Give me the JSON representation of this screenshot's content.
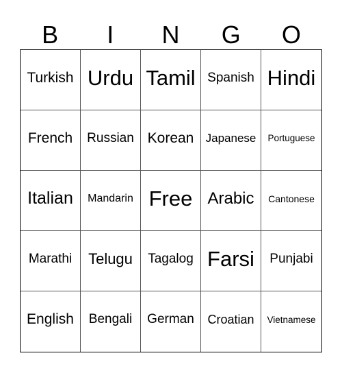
{
  "header": {
    "letters": [
      "B",
      "I",
      "N",
      "G",
      "O"
    ]
  },
  "card": {
    "rows": [
      [
        "Turkish",
        "Urdu",
        "Tamil",
        "Spanish",
        "Hindi"
      ],
      [
        "French",
        "Russian",
        "Korean",
        "Japanese",
        "Portuguese"
      ],
      [
        "Italian",
        "Mandarin",
        "Free",
        "Arabic",
        "Cantonese"
      ],
      [
        "Marathi",
        "Telugu",
        "Tagalog",
        "Farsi",
        "Punjabi"
      ],
      [
        "English",
        "Bengali",
        "German",
        "Croatian",
        "Vietnamese"
      ]
    ]
  },
  "colors": {
    "background": "#ffffff",
    "text": "#000000",
    "grid_line": "#555555"
  }
}
